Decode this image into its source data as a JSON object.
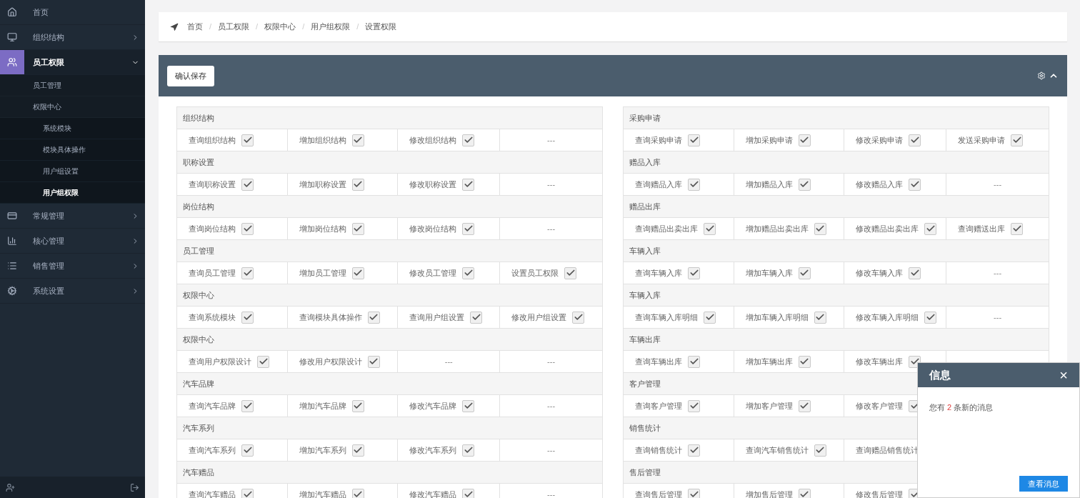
{
  "sidebar": {
    "items": [
      {
        "label": "首页",
        "selected": false
      },
      {
        "label": "组织结构",
        "selected": false,
        "expanded": false
      },
      {
        "label": "员工权限",
        "selected": true,
        "expanded": true,
        "children": [
          {
            "label": "员工管理",
            "selected": false
          },
          {
            "label": "权限中心",
            "selected": false,
            "children": [
              {
                "label": "系统模块",
                "selected": false
              },
              {
                "label": "模块具体操作",
                "selected": false
              },
              {
                "label": "用户组设置",
                "selected": false
              },
              {
                "label": "用户组权限",
                "selected": true
              }
            ]
          }
        ]
      },
      {
        "label": "常规管理",
        "selected": false,
        "expanded": false
      },
      {
        "label": "核心管理",
        "selected": false,
        "expanded": false
      },
      {
        "label": "销售管理",
        "selected": false,
        "expanded": false
      },
      {
        "label": "系统设置",
        "selected": false,
        "expanded": false
      }
    ]
  },
  "breadcrumb": {
    "separator": "/",
    "items": [
      "首页",
      "员工权限",
      "权限中心",
      "用户组权限",
      "设置权限"
    ]
  },
  "panel": {
    "save_button": "确认保存"
  },
  "tables": [
    {
      "groups": [
        {
          "title": "组织结构",
          "cells": [
            {
              "kind": "perm",
              "label": "查询组织结构",
              "checked": true
            },
            {
              "kind": "perm",
              "label": "增加组织结构",
              "checked": true
            },
            {
              "kind": "perm",
              "label": "修改组织结构",
              "checked": true
            },
            {
              "kind": "empty",
              "text": "---"
            }
          ]
        },
        {
          "title": "职称设置",
          "cells": [
            {
              "kind": "perm",
              "label": "查询职称设置",
              "checked": true
            },
            {
              "kind": "perm",
              "label": "增加职称设置",
              "checked": true
            },
            {
              "kind": "perm",
              "label": "修改职称设置",
              "checked": true
            },
            {
              "kind": "empty",
              "text": "---"
            }
          ]
        },
        {
          "title": "岗位结构",
          "cells": [
            {
              "kind": "perm",
              "label": "查询岗位结构",
              "checked": true
            },
            {
              "kind": "perm",
              "label": "增加岗位结构",
              "checked": true
            },
            {
              "kind": "perm",
              "label": "修改岗位结构",
              "checked": true
            },
            {
              "kind": "empty",
              "text": "---"
            }
          ]
        },
        {
          "title": "员工管理",
          "cells": [
            {
              "kind": "perm",
              "label": "查询员工管理",
              "checked": true
            },
            {
              "kind": "perm",
              "label": "增加员工管理",
              "checked": true
            },
            {
              "kind": "perm",
              "label": "修改员工管理",
              "checked": true
            },
            {
              "kind": "perm",
              "label": "设置员工权限",
              "checked": true
            }
          ]
        },
        {
          "title": "权限中心",
          "cells": [
            {
              "kind": "perm",
              "label": "查询系统模块",
              "checked": true
            },
            {
              "kind": "perm",
              "label": "查询模块具体操作",
              "checked": true
            },
            {
              "kind": "perm",
              "label": "查询用户组设置",
              "checked": true
            },
            {
              "kind": "perm",
              "label": "修改用户组设置",
              "checked": true
            }
          ]
        },
        {
          "title": "权限中心",
          "cells": [
            {
              "kind": "perm",
              "label": "查询用户权限设计",
              "checked": true
            },
            {
              "kind": "perm",
              "label": "修改用户权限设计",
              "checked": true
            },
            {
              "kind": "empty",
              "text": "---"
            },
            {
              "kind": "empty",
              "text": "---"
            }
          ]
        },
        {
          "title": "汽车品牌",
          "cells": [
            {
              "kind": "perm",
              "label": "查询汽车品牌",
              "checked": true
            },
            {
              "kind": "perm",
              "label": "增加汽车品牌",
              "checked": true
            },
            {
              "kind": "perm",
              "label": "修改汽车品牌",
              "checked": true
            },
            {
              "kind": "empty",
              "text": "---"
            }
          ]
        },
        {
          "title": "汽车系列",
          "cells": [
            {
              "kind": "perm",
              "label": "查询汽车系列",
              "checked": true
            },
            {
              "kind": "perm",
              "label": "增加汽车系列",
              "checked": true
            },
            {
              "kind": "perm",
              "label": "修改汽车系列",
              "checked": true
            },
            {
              "kind": "empty",
              "text": "---"
            }
          ]
        },
        {
          "title": "汽车赠品",
          "cells": [
            {
              "kind": "perm",
              "label": "查询汽车赠品",
              "checked": true
            },
            {
              "kind": "perm",
              "label": "增加汽车赠品",
              "checked": true
            },
            {
              "kind": "perm",
              "label": "修改汽车赠品",
              "checked": true
            },
            {
              "kind": "empty",
              "text": "---"
            }
          ]
        }
      ]
    },
    {
      "groups": [
        {
          "title": "采购申请",
          "cells": [
            {
              "kind": "perm",
              "label": "查询采购申请",
              "checked": true
            },
            {
              "kind": "perm",
              "label": "增加采购申请",
              "checked": true
            },
            {
              "kind": "perm",
              "label": "修改采购申请",
              "checked": true
            },
            {
              "kind": "perm",
              "label": "发送采购申请",
              "checked": true
            }
          ]
        },
        {
          "title": "赠品入库",
          "cells": [
            {
              "kind": "perm",
              "label": "查询赠品入库",
              "checked": true
            },
            {
              "kind": "perm",
              "label": "增加赠品入库",
              "checked": true
            },
            {
              "kind": "perm",
              "label": "修改赠品入库",
              "checked": true
            },
            {
              "kind": "empty",
              "text": "---"
            }
          ]
        },
        {
          "title": "赠品出库",
          "cells": [
            {
              "kind": "perm",
              "label": "查询赠品出卖出库",
              "checked": true
            },
            {
              "kind": "perm",
              "label": "增加赠品出卖出库",
              "checked": true
            },
            {
              "kind": "perm",
              "label": "修改赠品出卖出库",
              "checked": true
            },
            {
              "kind": "perm",
              "label": "查询赠送出库",
              "checked": true
            }
          ]
        },
        {
          "title": "车辆入库",
          "cells": [
            {
              "kind": "perm",
              "label": "查询车辆入库",
              "checked": true
            },
            {
              "kind": "perm",
              "label": "增加车辆入库",
              "checked": true
            },
            {
              "kind": "perm",
              "label": "修改车辆入库",
              "checked": true
            },
            {
              "kind": "empty",
              "text": "---"
            }
          ]
        },
        {
          "title": "车辆入库",
          "cells": [
            {
              "kind": "perm",
              "label": "查询车辆入库明细",
              "checked": true
            },
            {
              "kind": "perm",
              "label": "增加车辆入库明细",
              "checked": true
            },
            {
              "kind": "perm",
              "label": "修改车辆入库明细",
              "checked": true
            },
            {
              "kind": "empty",
              "text": "---"
            }
          ]
        },
        {
          "title": "车辆出库",
          "cells": [
            {
              "kind": "perm",
              "label": "查询车辆出库",
              "checked": true
            },
            {
              "kind": "perm",
              "label": "增加车辆出库",
              "checked": true
            },
            {
              "kind": "perm",
              "label": "修改车辆出库",
              "checked": true
            }
          ]
        },
        {
          "title": "客户管理",
          "cells": [
            {
              "kind": "perm",
              "label": "查询客户管理",
              "checked": true
            },
            {
              "kind": "perm",
              "label": "增加客户管理",
              "checked": true
            },
            {
              "kind": "perm",
              "label": "修改客户管理",
              "checked": true
            }
          ]
        },
        {
          "title": "销售统计",
          "cells": [
            {
              "kind": "perm",
              "label": "查询销售统计",
              "checked": true
            },
            {
              "kind": "perm",
              "label": "查询汽车销售统计",
              "checked": true
            },
            {
              "kind": "label",
              "label": "查询赠品销售统计"
            }
          ]
        },
        {
          "title": "售后管理",
          "cells": [
            {
              "kind": "perm",
              "label": "查询售后管理",
              "checked": true
            },
            {
              "kind": "perm",
              "label": "增加售后管理",
              "checked": true
            },
            {
              "kind": "perm",
              "label": "修改售后管理",
              "checked": true
            }
          ]
        }
      ]
    }
  ],
  "popup": {
    "title": "信息",
    "close": "×",
    "text_before": "您有",
    "count": "2",
    "text_after": "条新的消息",
    "button": "查看消息"
  }
}
